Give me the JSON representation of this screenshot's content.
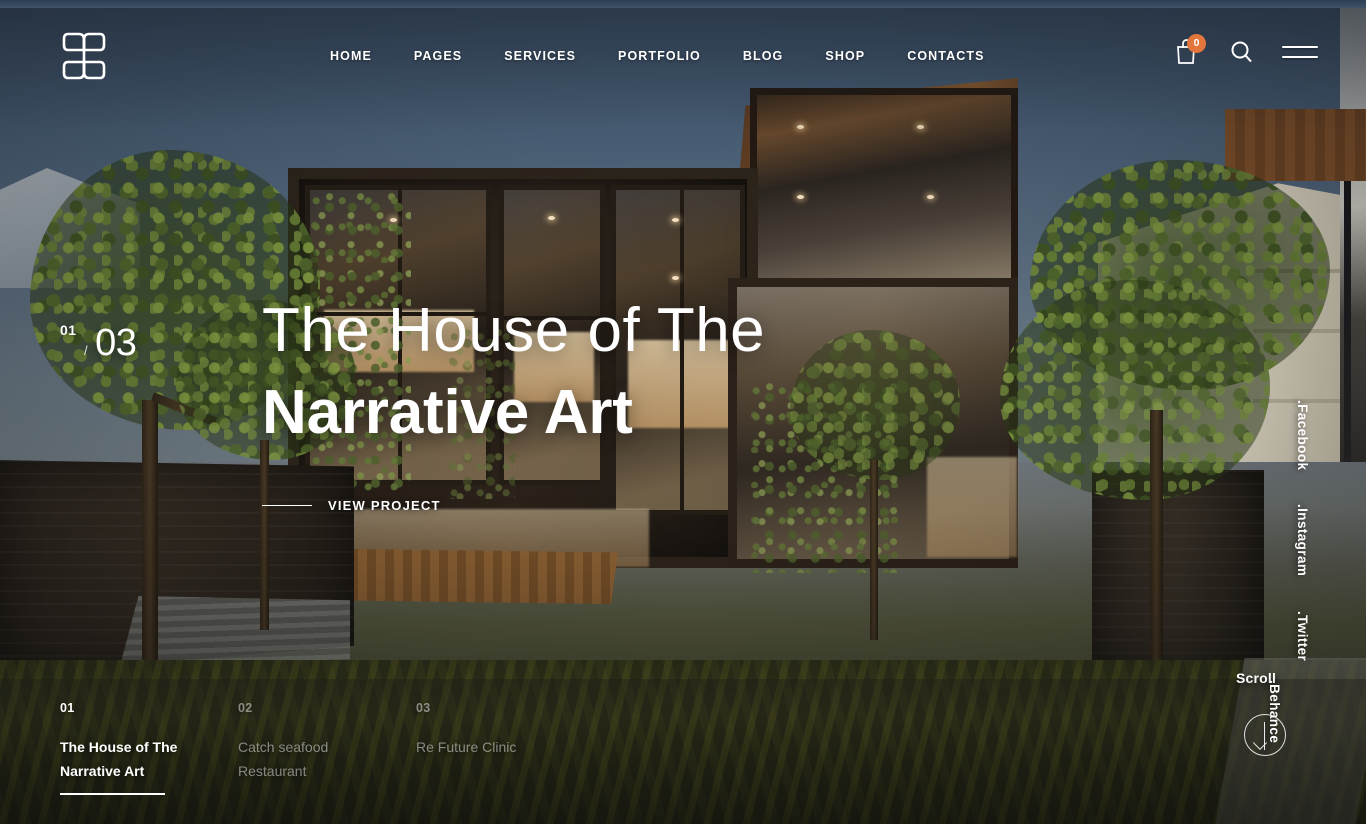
{
  "site": {
    "logo_name": "h-monogram-logo"
  },
  "header": {
    "nav": [
      {
        "label": "HOME",
        "name": "nav-item-home"
      },
      {
        "label": "PAGES",
        "name": "nav-item-pages"
      },
      {
        "label": "SERVICES",
        "name": "nav-item-services"
      },
      {
        "label": "PORTFOLIO",
        "name": "nav-item-portfolio"
      },
      {
        "label": "BLOG",
        "name": "nav-item-blog"
      },
      {
        "label": "SHOP",
        "name": "nav-item-shop"
      },
      {
        "label": "CONTACTS",
        "name": "nav-item-contacts"
      }
    ],
    "cart": {
      "icon": "shopping-bag-icon",
      "count": "0",
      "badge_color": "#e2763c"
    },
    "search": {
      "icon": "search-icon"
    },
    "menu": {
      "icon": "hamburger-menu-icon"
    }
  },
  "hero": {
    "counter": {
      "current": "01",
      "separator": "/",
      "total": "03"
    },
    "title_line1": "The House of The",
    "title_line2": "Narrative Art",
    "cta_label": "VIEW PROJECT"
  },
  "socials": [
    {
      "label": ".Facebook",
      "name": "social-link-facebook"
    },
    {
      "label": ".Instagram",
      "name": "social-link-instagram"
    },
    {
      "label": ".Twitter",
      "name": "social-link-twitter"
    },
    {
      "label": ".Behance",
      "name": "social-link-behance"
    }
  ],
  "scroll": {
    "label": "Scroll",
    "arrow_icon": "arrow-down-icon"
  },
  "slider": {
    "items": [
      {
        "num": "01",
        "title": "The House of The Narrative Art",
        "active": true
      },
      {
        "num": "02",
        "title": "Catch seafood Restaurant",
        "active": false
      },
      {
        "num": "03",
        "title": "Re Future Clinic",
        "active": false
      }
    ]
  },
  "colors": {
    "accent": "#e2763c",
    "text_on_image": "#ffffff",
    "muted_text": "rgba(255,255,255,0.48)"
  }
}
